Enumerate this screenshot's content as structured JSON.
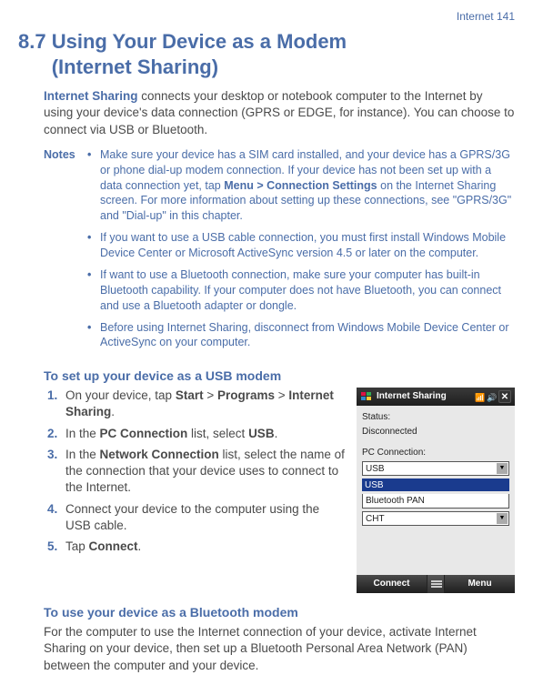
{
  "breadcrumb": {
    "chapter": "Internet",
    "page": "141"
  },
  "heading": {
    "number": "8.7",
    "title": "Using Your Device as a Modem",
    "subtitle": "(Internet Sharing)"
  },
  "intro": {
    "term": "Internet Sharing",
    "text": " connects your desktop or notebook computer to the Internet by using your device's data connection (GPRS or EDGE, for instance). You can choose to connect via USB or Bluetooth."
  },
  "notes": {
    "label": "Notes",
    "items": [
      {
        "pre": "Make sure your device has a SIM card installed, and your device has a GPRS/3G or phone dial-up modem connection. If your device has not been set up with a data connection yet, tap ",
        "bold": "Menu > Connection Settings",
        "post": " on the Internet Sharing screen. For more information about setting up these connections, see \"GPRS/3G\" and \"Dial-up\" in this chapter."
      },
      {
        "pre": "If you want to use a USB cable connection, you must first install Windows Mobile Device Center or Microsoft ActiveSync version 4.5 or later on the computer.",
        "bold": "",
        "post": ""
      },
      {
        "pre": "If want to use a Bluetooth connection, make sure your computer has built-in Bluetooth capability. If your computer does not have Bluetooth, you can connect and use a Bluetooth adapter or dongle.",
        "bold": "",
        "post": ""
      },
      {
        "pre": "Before using Internet Sharing, disconnect from Windows Mobile Device Center or ActiveSync on your computer.",
        "bold": "",
        "post": ""
      }
    ]
  },
  "section_usb": {
    "heading": "To set up your device as a USB modem",
    "steps": [
      {
        "num": "1.",
        "parts": [
          "On your device, tap ",
          "Start",
          " > ",
          "Programs",
          " > ",
          "Internet Sharing",
          "."
        ]
      },
      {
        "num": "2.",
        "parts": [
          "In the ",
          "PC Connection",
          " list, select ",
          "USB",
          "."
        ]
      },
      {
        "num": "3.",
        "parts": [
          "In the ",
          "Network Connection",
          " list, select the name of the connection that your device uses to connect to the Internet."
        ]
      },
      {
        "num": "4.",
        "parts": [
          "Connect your device to the computer using the USB cable."
        ]
      },
      {
        "num": "5.",
        "parts": [
          "Tap ",
          "Connect",
          "."
        ]
      }
    ]
  },
  "screenshot": {
    "title": "Internet Sharing",
    "status_label": "Status:",
    "status_value": "Disconnected",
    "pc_label": "PC Connection:",
    "pc_usb": "USB",
    "pc_selected": "USB",
    "pc_bt": "Bluetooth PAN",
    "net_value": "CHT",
    "left_softkey": "Connect",
    "right_softkey": "Menu"
  },
  "section_bt": {
    "heading": "To use your device as a Bluetooth modem",
    "text": "For the computer to use the Internet connection of your device, activate Internet Sharing on your device, then set up a Bluetooth Personal Area Network (PAN) between the computer and your device."
  }
}
